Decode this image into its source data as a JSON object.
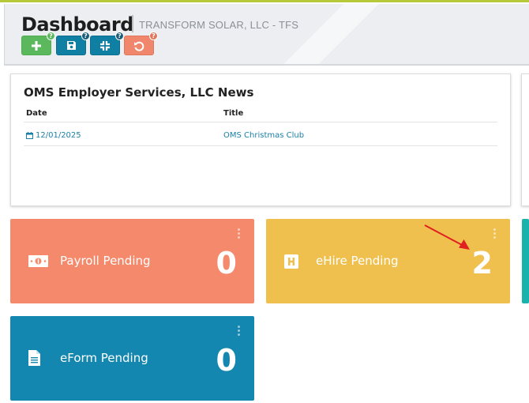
{
  "header": {
    "title": "Dashboard",
    "company": "TRANSFORM SOLAR, LLC - TFS"
  },
  "toolbar": {
    "buttons": [
      {
        "icon": "plus-icon",
        "help": "?",
        "color": "#5cb85c"
      },
      {
        "icon": "save-icon",
        "help": "?",
        "color": "#0f7fa3"
      },
      {
        "icon": "minimize-icon",
        "help": "?",
        "color": "#0f7fa3"
      },
      {
        "icon": "undo-icon",
        "help": "?",
        "color": "#f0876d"
      }
    ]
  },
  "news": {
    "title": "OMS Employer Services, LLC News",
    "columns": {
      "date": "Date",
      "title": "Title"
    },
    "rows": [
      {
        "date": "12/01/2025",
        "title": "OMS Christmas Club"
      }
    ]
  },
  "tiles": {
    "payroll": {
      "label": "Payroll Pending",
      "count": "0",
      "icon": "money-icon",
      "color": "#f5896c"
    },
    "ehire": {
      "label": "eHire Pending",
      "count": "2",
      "icon": "hire-icon",
      "color": "#f0c04f"
    },
    "eform": {
      "label": "eForm Pending",
      "count": "0",
      "icon": "document-icon",
      "color": "#1387b0"
    }
  },
  "colors": {
    "accent": "#1a7fa8",
    "annotation_arrow": "#e02020"
  }
}
